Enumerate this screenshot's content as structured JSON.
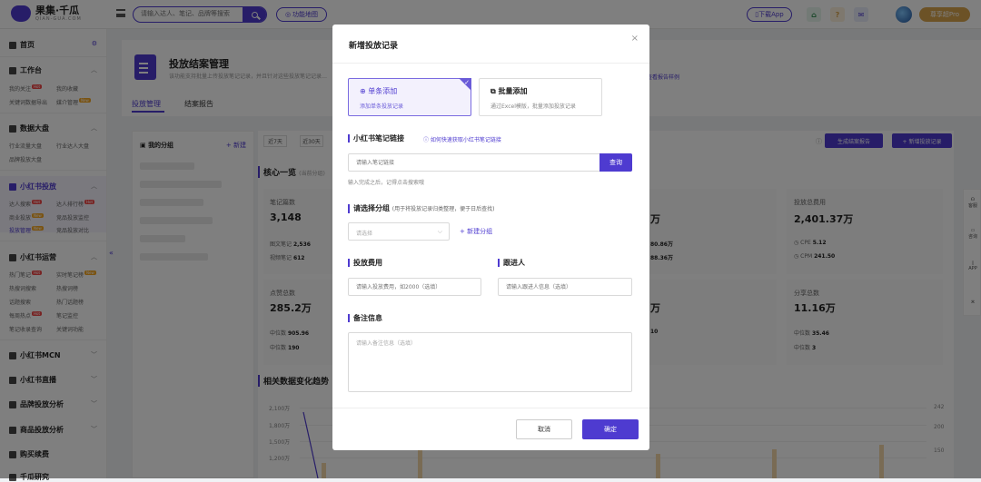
{
  "topbar": {
    "logo_text": "果集·千瓜",
    "logo_sub": "QIAN-GUA.COM",
    "search_placeholder": "请输入达人、笔记、品牌等搜索",
    "func_map_label": "功能地图",
    "download_label": "下载App",
    "vip_label": "尊享超Pro"
  },
  "sidebar": {
    "home": "首页",
    "workbench": "工作台",
    "workbench_items": [
      "我的关注",
      "我的收藏",
      "关键词数据导出",
      "媒介管理"
    ],
    "dashboard": "数据大盘",
    "dashboard_items": [
      "行业流量大盘",
      "行业达人大盘",
      "品牌投放大盘"
    ],
    "xhs_ads": "小红书投放",
    "xhs_ads_items": [
      "达人搜索",
      "达人排行榜",
      "商业投放",
      "竞品投放监控",
      "投放管理",
      "竞品投放对比"
    ],
    "xhs_ops": "小红书运营",
    "xhs_ops_items": [
      "热门笔记",
      "实时笔记榜",
      "热搜词搜索",
      "热搜词榜",
      "话题搜索",
      "热门话题榜",
      "每周热点",
      "笔记监控",
      "笔记收录查询",
      "关键词功能"
    ],
    "mcn": "小红书MCN",
    "live": "小红书直播",
    "brand_analysis": "品牌投放分析",
    "product_analysis": "商品投放分析",
    "purchase": "购买续费",
    "more": "千瓜研究",
    "badge_hot": "Hot",
    "badge_new": "New"
  },
  "page": {
    "title": "投放结案管理",
    "desc": "该功能支持批量上传投放笔记记录，并且针对这些投放笔记记录…",
    "help_link": "查看报告样例",
    "tabs": [
      "投放管理",
      "结案报告"
    ]
  },
  "content": {
    "my_groups": "我的分组",
    "new_group": "+ 新建",
    "date_chips": [
      "近7天",
      "近30天"
    ],
    "gen_report": "生成结案报告",
    "add_record": "+ 新增投放记录",
    "core_title": "核心一览",
    "core_hint": "(当前分组)",
    "notes_label": "笔记篇数",
    "notes_val": "3,148",
    "graphic_notes": "图文笔记",
    "graphic_val": "2,536",
    "video_notes": "视频笔记",
    "video_val": "612",
    "likes_label": "点赞总数",
    "likes_val": "285.2万",
    "median_label": "中位数",
    "likes_median": "905.96",
    "likes_mid2": "190",
    "partial_val_1": "万",
    "partial_val_2": "80.86万",
    "partial_val_3": "88.36万",
    "partial_val_4": "万",
    "partial_val_5": "10",
    "cost_label": "投放总费用",
    "cost_val": "2,401.37万",
    "cpe_label": "CPE",
    "cpe_val": "5.12",
    "cpm_label": "CPM",
    "cpm_val": "241.50",
    "share_label": "分享总数",
    "share_val": "11.16万",
    "share_median": "35.46",
    "share_mid2": "3",
    "trend_title": "相关数据变化趋势",
    "y_left": [
      "2,100万",
      "1,800万",
      "1,500万",
      "1,200万"
    ],
    "y_right": [
      "242",
      "200",
      "150"
    ]
  },
  "right_float": [
    "客服",
    "咨询",
    "APP"
  ],
  "modal": {
    "title": "新增投放记录",
    "single_title": "单条添加",
    "single_desc": "添加单条投放记录",
    "batch_title": "批量添加",
    "batch_desc": "通过Excel模版，批量添加投放记录",
    "link_label": "小红书笔记链接",
    "link_tip": "如何快速获取小红书笔记链接",
    "link_placeholder": "请输入笔记链接",
    "query_btn": "查询",
    "link_help": "输入完成之后，记得点击搜索哦",
    "group_label": "请选择分组",
    "group_hint": "(用于将投放记录归类整理，便于日后查找)",
    "group_placeholder": "请选择",
    "add_group": "+ 新建分组",
    "cost_label": "投放费用",
    "cost_placeholder": "请输入投放费用，如2000（选填）",
    "follower_label": "跟进人",
    "follower_placeholder": "请输入跟进人信息（选填）",
    "remark_label": "备注信息",
    "remark_placeholder": "请输入备注信息（选填）",
    "cancel": "取消",
    "confirm": "确定"
  },
  "colors": {
    "accent": "#4e3bd0",
    "gold": "#d9a44c",
    "hot": "#f04848"
  }
}
